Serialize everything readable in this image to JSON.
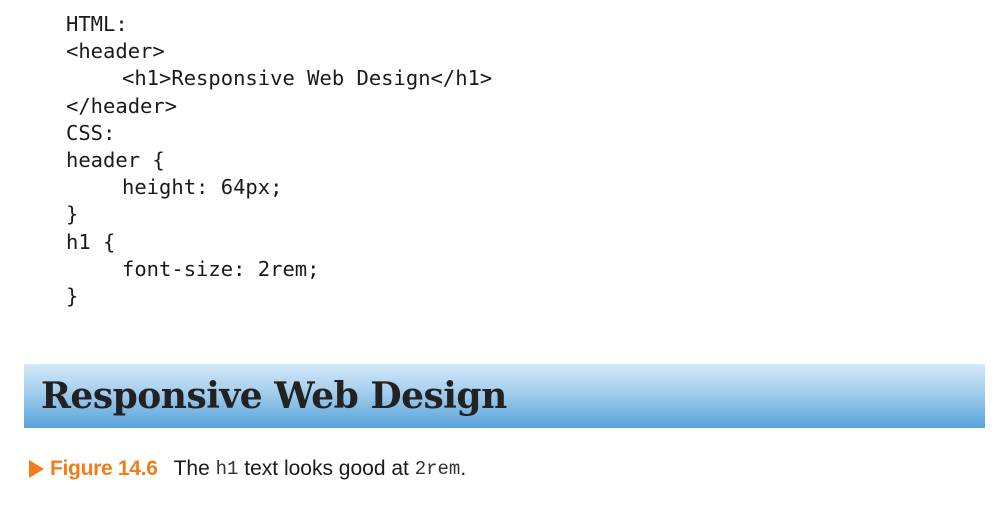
{
  "code": {
    "lines": [
      {
        "text": "HTML:",
        "indent": false
      },
      {
        "text": "<header>",
        "indent": false
      },
      {
        "text": "<h1>Responsive Web Design</h1>",
        "indent": true
      },
      {
        "text": "</header>",
        "indent": false
      },
      {
        "text": "CSS:",
        "indent": false
      },
      {
        "text": "header {",
        "indent": false
      },
      {
        "text": "height: 64px;",
        "indent": true
      },
      {
        "text": "}",
        "indent": false
      },
      {
        "text": "h1 {",
        "indent": false
      },
      {
        "text": "font-size: 2rem;",
        "indent": true
      },
      {
        "text": "}",
        "indent": false
      }
    ]
  },
  "demo": {
    "heading": "Responsive Web Design",
    "gradient_top": "#d3e8f7",
    "gradient_bottom": "#5aa3dc"
  },
  "caption": {
    "icon": "play-arrow-icon",
    "accent_color": "#f07d1a",
    "figure_label": "Figure 14.6",
    "text_before": "The ",
    "code1": "h1",
    "text_middle": " text looks good at ",
    "code2": "2rem",
    "text_after": "."
  }
}
